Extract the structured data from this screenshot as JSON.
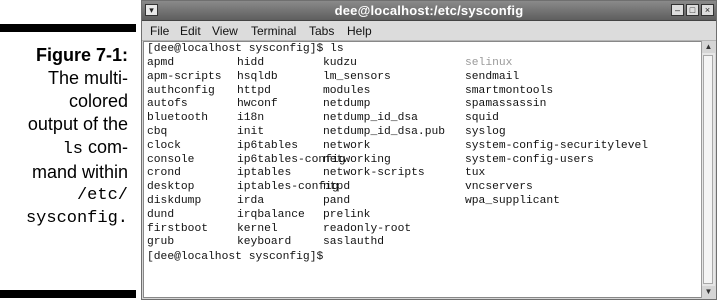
{
  "caption": {
    "figure": "Figure 7-1:",
    "lines": [
      "The multi-",
      "colored",
      "output of the"
    ],
    "ls": "ls",
    "com_suffix": " com-",
    "mand": "mand within",
    "path1": "/etc/",
    "path2": "sysconfig."
  },
  "window": {
    "title": "dee@localhost:/etc/sysconfig",
    "menu": [
      "File",
      "Edit",
      "View",
      "Terminal",
      "Tabs",
      "Help"
    ],
    "controls": {
      "minimize": "–",
      "maximize": "□",
      "close": "×"
    }
  },
  "terminal": {
    "prompt_cmd": "[dee@localhost sysconfig]$ ls",
    "prompt_end": "[dee@localhost sysconfig]$",
    "columns": [
      [
        "apmd",
        "apm-scripts",
        "authconfig",
        "autofs",
        "bluetooth",
        "cbq",
        "clock",
        "console",
        "crond",
        "desktop",
        "diskdump",
        "dund",
        "firstboot",
        "grub"
      ],
      [
        "hidd",
        "hsqldb",
        "httpd",
        "hwconf",
        "i18n",
        "init",
        "ip6tables",
        "ip6tables-config",
        "iptables",
        "iptables-config",
        "irda",
        "irqbalance",
        "kernel",
        "keyboard"
      ],
      [
        "kudzu",
        "lm_sensors",
        "modules",
        "netdump",
        "netdump_id_dsa",
        "netdump_id_dsa.pub",
        "network",
        "networking",
        "network-scripts",
        "ntpd",
        "pand",
        "prelink",
        "readonly-root",
        "saslauthd"
      ],
      [
        "selinux",
        "sendmail",
        "smartmontools",
        "spamassassin",
        "squid",
        "syslog",
        "system-config-securitylevel",
        "system-config-users",
        "tux",
        "vncservers",
        "wpa_supplicant"
      ]
    ],
    "dim_entries": [
      "selinux"
    ]
  }
}
